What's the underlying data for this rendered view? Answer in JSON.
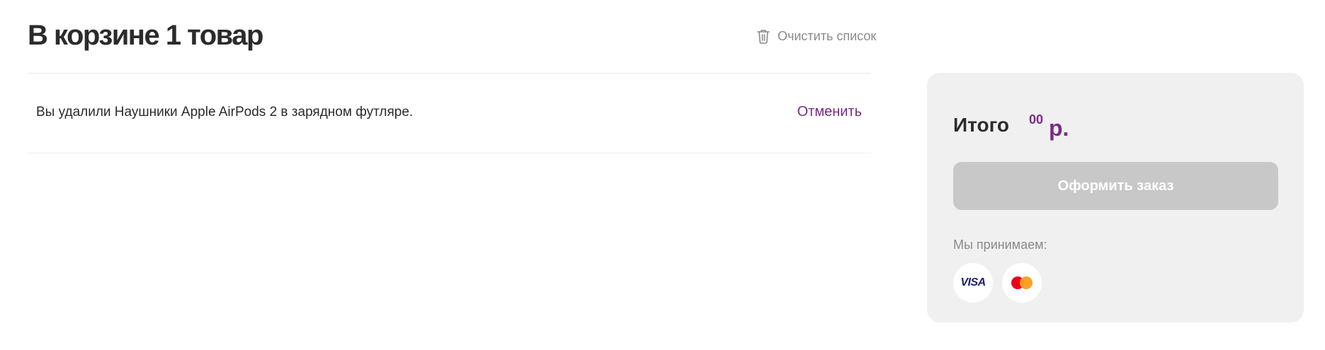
{
  "header": {
    "title": "В корзине 1 товар",
    "clear_label": "Очистить список"
  },
  "notice": {
    "text": "Вы удалили Наушники Apple AirPods 2 в зарядном футляре.",
    "undo_label": "Отменить"
  },
  "summary": {
    "total_label": "Итого",
    "kopecks": "00",
    "currency": "р.",
    "checkout_label": "Оформить заказ",
    "accept_label": "Мы принимаем:",
    "payment_methods": [
      {
        "name": "VISA",
        "icon": "visa-icon"
      },
      {
        "name": "Mastercard",
        "icon": "mastercard-icon"
      }
    ]
  },
  "colors": {
    "accent": "#7b2a86",
    "panel_bg": "#f0f0f0",
    "button_disabled": "#c8c8c8",
    "muted_text": "#8a8a8a"
  }
}
